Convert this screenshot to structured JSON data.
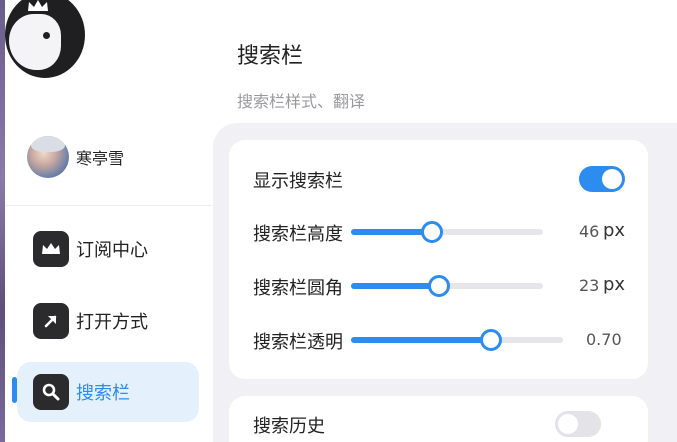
{
  "sidebar": {
    "user": {
      "name": "寒亭雪"
    },
    "items": [
      {
        "label": "订阅中心",
        "icon": "crown-icon",
        "active": false
      },
      {
        "label": "打开方式",
        "icon": "arrow-up-right-icon",
        "active": false
      },
      {
        "label": "搜索栏",
        "icon": "search-icon",
        "active": true
      }
    ]
  },
  "header": {
    "title": "搜索栏",
    "subtitle": "搜索栏样式、翻译"
  },
  "settings": {
    "show_search_bar": {
      "label": "显示搜索栏",
      "on": true
    },
    "height": {
      "label": "搜索栏高度",
      "value": "46",
      "unit": "px",
      "fraction": 0.42
    },
    "radius": {
      "label": "搜索栏圆角",
      "value": "23",
      "unit": "px",
      "fraction": 0.46
    },
    "opacity": {
      "label": "搜索栏透明",
      "value": "0.70",
      "fraction": 0.66
    },
    "history": {
      "label": "搜索历史",
      "on": false
    }
  },
  "colors": {
    "accent": "#2d8cf0",
    "active_bg": "#e5f0fd",
    "content_bg": "#f1f1f5"
  }
}
